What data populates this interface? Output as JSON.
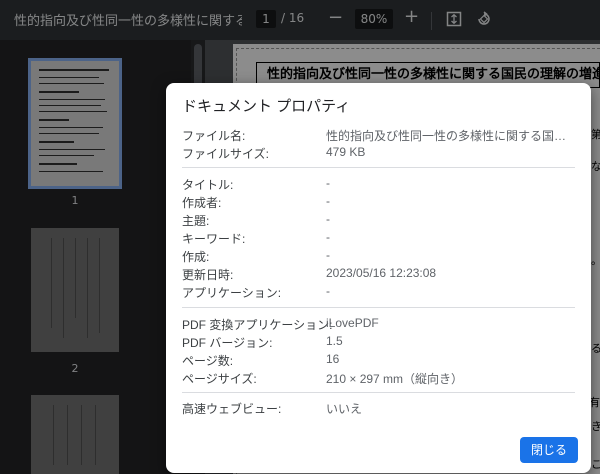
{
  "toolbar": {
    "doc_title": "性的指向及び性同一性の多様性に関する...",
    "page_current": "1",
    "page_total": "/ 16",
    "zoom_minus": "−",
    "zoom_value": "80%",
    "zoom_plus": "+"
  },
  "sidebar": {
    "thumbnails": [
      {
        "page_label": "1"
      },
      {
        "page_label": "2"
      },
      {
        "page_label": "3"
      }
    ]
  },
  "document": {
    "heading": "性的指向及び性同一性の多様性に関する国民の理解の増進",
    "edge_chars": [
      "第",
      "な",
      "。",
      "る",
      "有",
      "き",
      "こ"
    ]
  },
  "dialog": {
    "title": "ドキュメント プロパティ",
    "section1": [
      {
        "label": "ファイル名:",
        "value": "性的指向及び性同一性の多様性に関する国民の理..."
      },
      {
        "label": "ファイルサイズ:",
        "value": "479 KB"
      }
    ],
    "section2": [
      {
        "label": "タイトル:",
        "value": "-"
      },
      {
        "label": "作成者:",
        "value": "-"
      },
      {
        "label": "主題:",
        "value": "-"
      },
      {
        "label": "キーワード:",
        "value": "-"
      },
      {
        "label": "作成:",
        "value": "-"
      },
      {
        "label": "更新日時:",
        "value": "2023/05/16 12:23:08"
      },
      {
        "label": "アプリケーション:",
        "value": "-"
      }
    ],
    "section3": [
      {
        "label": "PDF 変換アプリケーション:",
        "value": "iLovePDF"
      },
      {
        "label": "PDF バージョン:",
        "value": "1.5"
      },
      {
        "label": "ページ数:",
        "value": "16"
      },
      {
        "label": "ページサイズ:",
        "value": "210 × 297 mm（縦向き）"
      }
    ],
    "section4": [
      {
        "label": "高速ウェブビュー:",
        "value": "いいえ"
      }
    ],
    "close_label": "閉じる"
  },
  "colors": {
    "accent": "#1a73e8",
    "toolbar_bg": "#323639",
    "thumb_selected_border": "#8ab4f8"
  }
}
